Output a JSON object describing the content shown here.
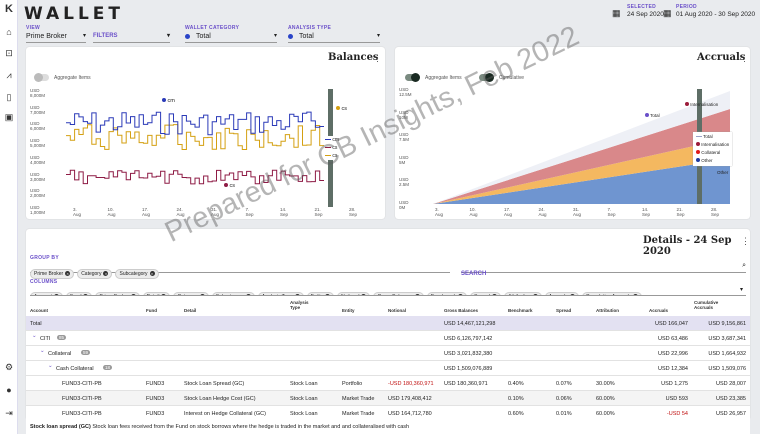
{
  "app": {
    "logo": "K",
    "title": "WALLET"
  },
  "filters": {
    "view_label": "VIEW",
    "view_value": "Prime Broker",
    "filters_label": "FILTERS",
    "category_label": "WALLET CATEGORY",
    "category_value": "Total",
    "analysis_label": "ANALYSIS TYPE",
    "analysis_value": "Total",
    "selected_label": "SELECTED",
    "selected_value": "24 Sep 2020",
    "period_label": "PERIOD",
    "period_value": "01 Aug 2020 - 30 Sep 2020"
  },
  "balances": {
    "title": "Balances",
    "toggle_label": "Aggregate Items",
    "y_ticks": [
      "USD 8,000M",
      "USD 7,000M",
      "USD 6,000M",
      "USD 5,000M",
      "USD 4,000M",
      "USD 3,000M",
      "USD 2,000M",
      "USD 1,000M"
    ],
    "x_ticks": [
      "3. Aug",
      "10. Aug",
      "17. Aug",
      "24. Aug",
      "31. Aug",
      "7. Sep",
      "14. Sep",
      "21. Sep",
      "28. Sep"
    ],
    "labels": {
      "cm": "cm",
      "cs_top": "cs",
      "cs_bottom": "cs"
    },
    "legend": [
      "cm",
      "cs",
      "cs"
    ],
    "colors": {
      "cm": "#2b3ab8",
      "cs_gold": "#d4a012",
      "cs_maroon": "#8e1b45"
    }
  },
  "accruals": {
    "title": "Accruals",
    "toggle1_label": "Aggregate Items",
    "toggle2_label": "Cumulative",
    "y_ticks": [
      "USD 12.5M",
      "USD 10M",
      "USD 7.5M",
      "USD 5M",
      "USD 2.5M",
      "USD 0M"
    ],
    "x_ticks": [
      "3. Aug",
      "10. Aug",
      "17. Aug",
      "24. Aug",
      "31. Aug",
      "7. Sep",
      "14. Sep",
      "21. Sep",
      "28. Sep"
    ],
    "point_labels": {
      "internalisation": "Internalisation",
      "total": "Total",
      "other": "Other"
    },
    "legend": [
      {
        "name": "Total",
        "color": "#9aa0c8"
      },
      {
        "name": "Internalisation",
        "color": "#9b1b3a"
      },
      {
        "name": "Collateral",
        "color": "#e01b1b"
      },
      {
        "name": "Other",
        "color": "#1e3aa0"
      }
    ]
  },
  "details": {
    "title": "Details - 24 Sep 2020",
    "group_by_label": "GROUP BY",
    "group_by_chips": [
      "Prime Broker",
      "Category",
      "Subcategory"
    ],
    "search_label": "SEARCH",
    "columns_label": "COLUMNS",
    "column_chips": [
      "Account",
      "Fund",
      "Prime Broker",
      "Detail",
      "Category",
      "Subcategory",
      "Analysis Type",
      "Entity",
      "Notional",
      "Gross Balances",
      "Benchmark",
      "Spread",
      "Attribution",
      "Accruals",
      "Cumulative Accruals"
    ],
    "headers": {
      "account": "Account",
      "fund": "Fund",
      "detail": "Detail",
      "analysis": "Analysis Type",
      "entity": "Entity",
      "notional": "Notional",
      "gross": "Gross Balances",
      "benchmark": "Benchmark",
      "spread": "Spread",
      "attribution": "Attribution",
      "accruals": "Accruals",
      "cum": "Cumulative Accruals"
    },
    "rows": [
      {
        "account": "Total",
        "gross": "USD 14,467,121,298",
        "accruals": "USD 166,047",
        "cum": "USD 9,156,861"
      },
      {
        "account": "CITI",
        "badge": "85",
        "gross": "USD 6,126,797,142",
        "accruals": "USD 63,486",
        "cum": "USD 3,687,341"
      },
      {
        "account": "Collateral",
        "badge": "59",
        "gross": "USD 3,021,832,380",
        "accruals": "USD 22,996",
        "cum": "USD 1,664,932"
      },
      {
        "account": "Cash Collateral",
        "badge": "18",
        "gross": "USD 1,509,076,889",
        "accruals": "USD 12,384",
        "cum": "USD 1,509,076"
      },
      {
        "account": "FUND3-CITI-PB",
        "fund": "FUND3",
        "detail": "Stock Loan Spread (GC)",
        "analysis": "Stock Loan",
        "entity": "Portfolio",
        "notional": "-USD 180,360,971",
        "gross": "USD 180,360,971",
        "benchmark": "0.40%",
        "spread": "0.07%",
        "attribution": "30.00%",
        "accruals": "USD 1,275",
        "cum": "USD 28,007"
      },
      {
        "account": "FUND3-CITI-PB",
        "fund": "FUND3",
        "detail": "Stock Loan Hedge Cost (GC)",
        "analysis": "Stock Loan",
        "entity": "Market Trade",
        "notional": "USD 179,408,412",
        "gross": "",
        "benchmark": "0.10%",
        "spread": "0.06%",
        "attribution": "60.00%",
        "accruals": "USD 593",
        "cum": "USD 23,385"
      },
      {
        "account": "FUND3-CITI-PB",
        "fund": "FUND3",
        "detail": "Interest on Hedge Collateral (GC)",
        "analysis": "Stock Loan",
        "entity": "Market Trade",
        "notional": "USD 164,712,780",
        "gross": "",
        "benchmark": "0.60%",
        "spread": "0.01%",
        "attribution": "60.00%",
        "accruals": "-USD 54",
        "cum": "USD 26,957"
      }
    ]
  },
  "footer": {
    "bold": "Stock loan spread (GC)",
    "text": "Stock loan fees received from the Fund on stock borrows where the hedge is traded in the market and and collateralised with cash"
  },
  "watermark": "Prepared for CB Insights, Feb 2022"
}
